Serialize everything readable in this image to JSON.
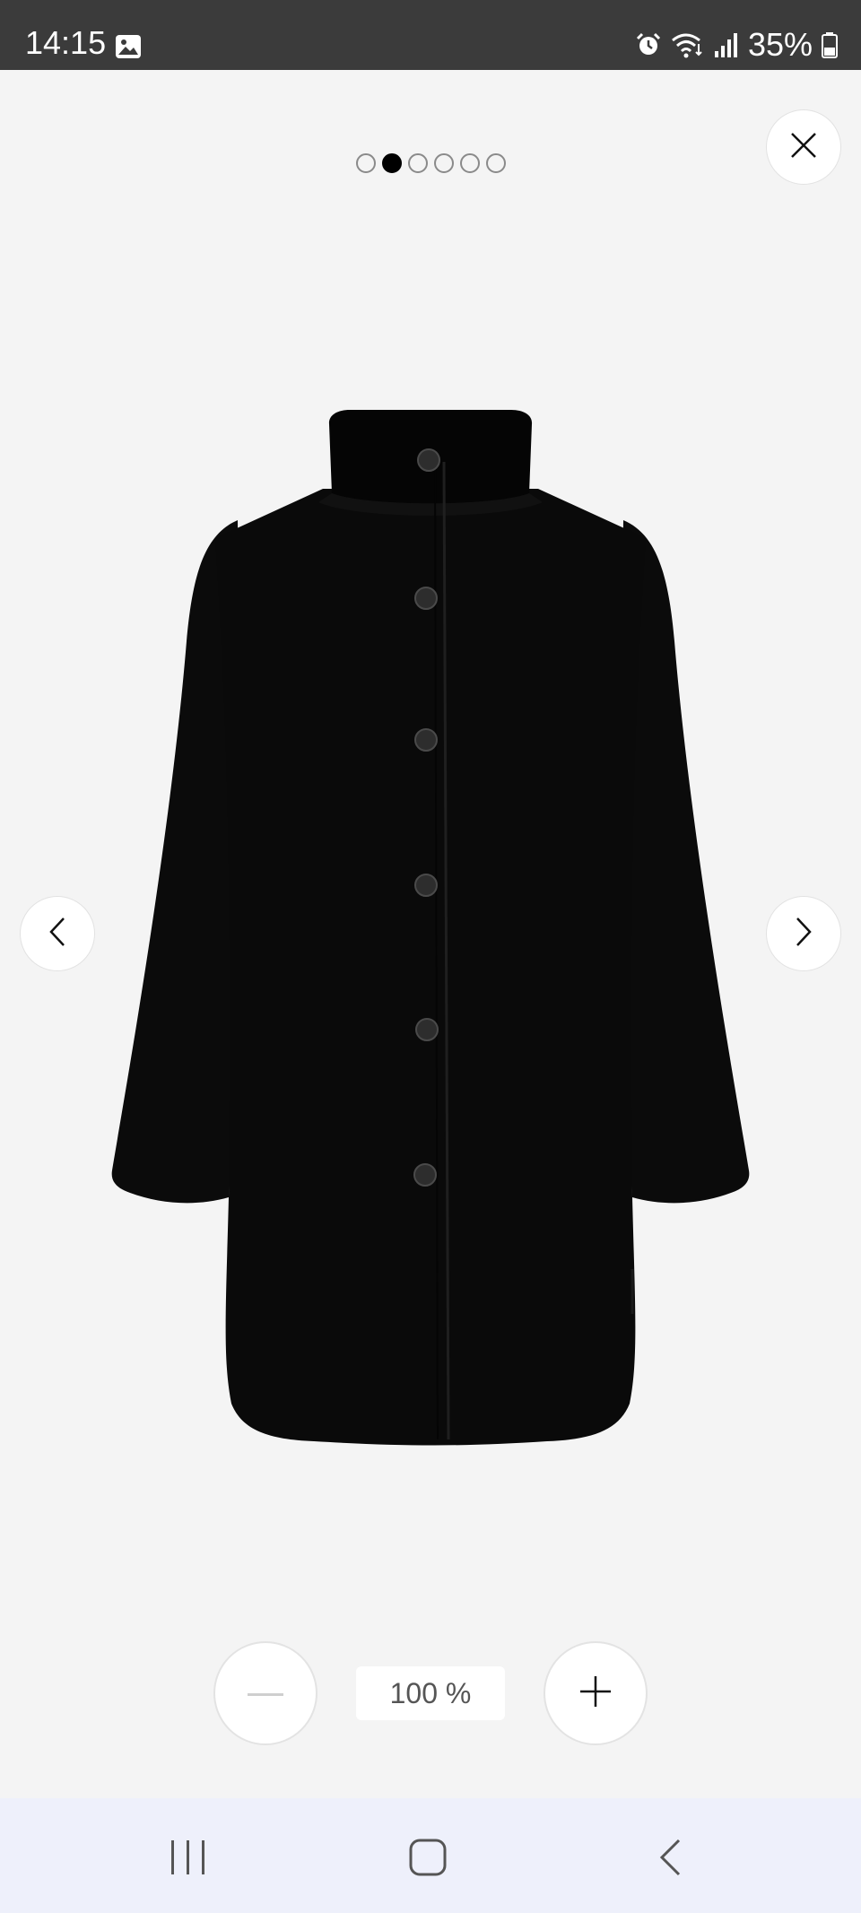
{
  "status_bar": {
    "time": "14:15",
    "battery": "35%",
    "icons": [
      "gallery-icon",
      "alarm-icon",
      "wifi-icon",
      "signal-icon",
      "battery-icon"
    ]
  },
  "viewer": {
    "pager": {
      "count": 6,
      "active_index": 1
    },
    "close_icon": "close-icon",
    "prev_icon": "chevron-left-icon",
    "next_icon": "chevron-right-icon",
    "product_image": "black-wool-coat"
  },
  "zoom": {
    "level": "100 %",
    "minus_icon": "minus-icon",
    "plus_icon": "plus-icon"
  },
  "navigation": {
    "recent_icon": "recent-apps-icon",
    "home_icon": "home-icon",
    "back_icon": "back-icon"
  },
  "colors": {
    "background": "#f4f4f4",
    "status_bar": "#3b3b3b",
    "nav_bar": "#eef0fb",
    "active_dot": "#000000"
  }
}
